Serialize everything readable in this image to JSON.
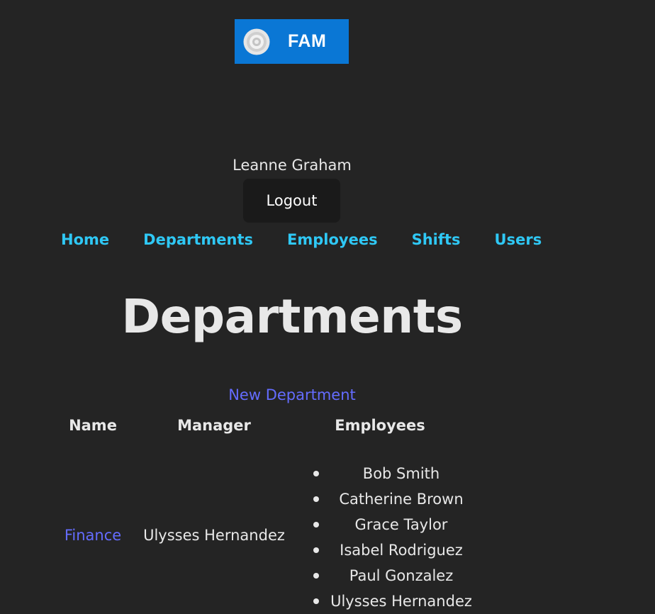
{
  "header": {
    "logo_text": "FAM",
    "logo_icon": "target-icon",
    "brand_color": "#0a77d5"
  },
  "user": {
    "name": "Leanne Graham",
    "logout_label": "Logout"
  },
  "nav": {
    "items": [
      {
        "label": "Home"
      },
      {
        "label": "Departments"
      },
      {
        "label": "Employees"
      },
      {
        "label": "Shifts"
      },
      {
        "label": "Users"
      }
    ],
    "link_color": "#2fc8f5"
  },
  "main": {
    "title": "Departments",
    "new_link": "New Department",
    "table": {
      "headers": [
        "Name",
        "Manager",
        "Employees"
      ],
      "rows": [
        {
          "name": "Finance",
          "manager": "Ulysses Hernandez",
          "employees": [
            "Bob Smith",
            "Catherine Brown",
            "Grace Taylor",
            "Isabel Rodriguez",
            "Paul Gonzalez",
            "Ulysses Hernandez"
          ]
        }
      ]
    }
  }
}
